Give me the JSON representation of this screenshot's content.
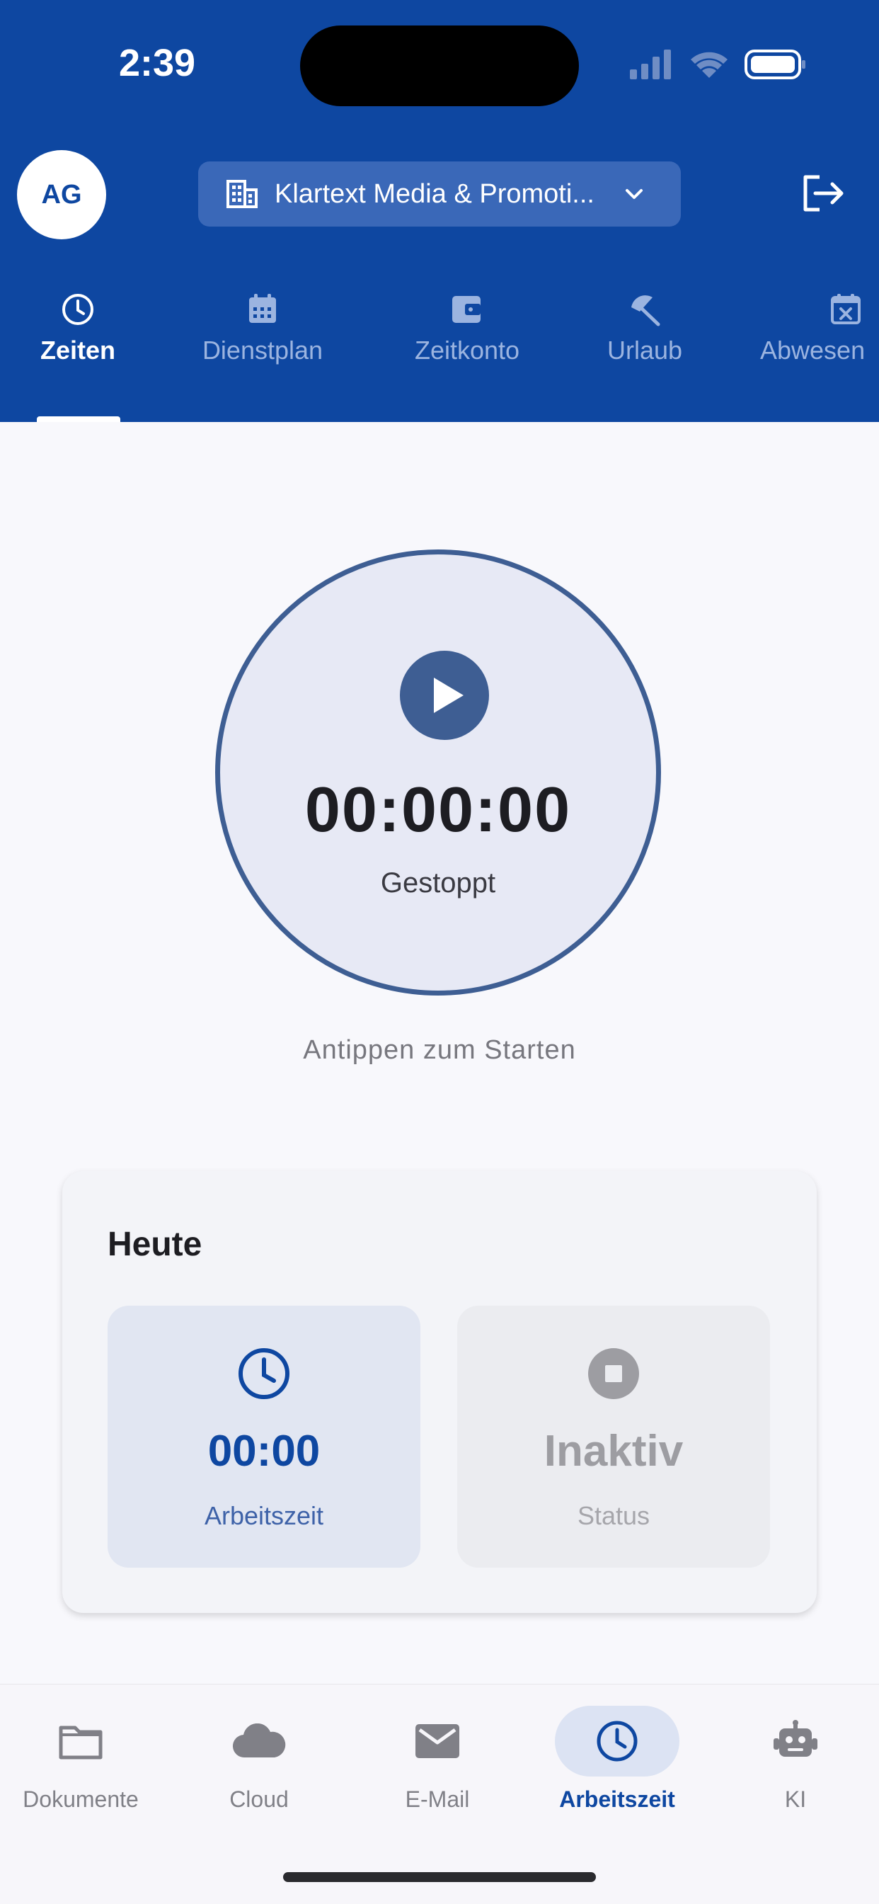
{
  "status_bar": {
    "time": "2:39"
  },
  "header": {
    "avatar_initials": "AG",
    "company_name": "Klartext Media & Promoti...",
    "tabs": [
      {
        "label": "Zeiten",
        "icon": "clock-icon",
        "active": true
      },
      {
        "label": "Dienstplan",
        "icon": "calendar-icon",
        "active": false
      },
      {
        "label": "Zeitkonto",
        "icon": "wallet-icon",
        "active": false
      },
      {
        "label": "Urlaub",
        "icon": "beach-umbrella-icon",
        "active": false
      },
      {
        "label": "Abwesen",
        "icon": "calendar-x-icon",
        "active": false
      }
    ]
  },
  "timer": {
    "value": "00:00:00",
    "status": "Gestoppt",
    "hint": "Antippen zum Starten"
  },
  "today": {
    "title": "Heute",
    "work_time": {
      "value": "00:00",
      "label": "Arbeitszeit"
    },
    "status": {
      "value": "Inaktiv",
      "label": "Status"
    }
  },
  "bottom_nav": [
    {
      "label": "Dokumente",
      "icon": "folder-icon",
      "active": false
    },
    {
      "label": "Cloud",
      "icon": "cloud-icon",
      "active": false
    },
    {
      "label": "E-Mail",
      "icon": "mail-icon",
      "active": false
    },
    {
      "label": "Arbeitszeit",
      "icon": "clock-icon",
      "active": true
    },
    {
      "label": "KI",
      "icon": "robot-icon",
      "active": false
    }
  ],
  "colors": {
    "primary": "#0E47A1",
    "timer_ring": "#3E5E93",
    "background": "#F8F8FC"
  }
}
